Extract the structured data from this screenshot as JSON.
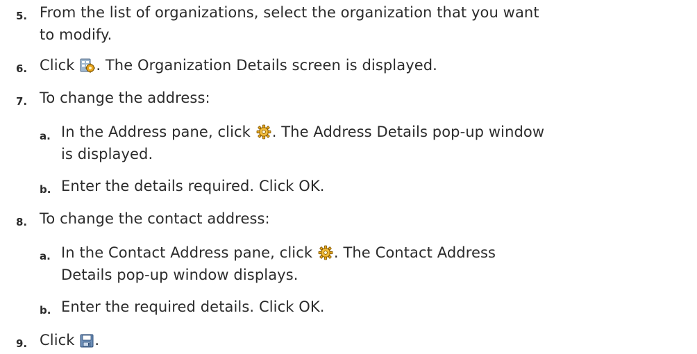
{
  "steps": [
    {
      "number": "5.",
      "line1": "From the list of organizations, select the organization that you want",
      "line2": "to modify."
    },
    {
      "number": "6.",
      "before": "Click ",
      "icon": "organization-details-icon",
      "after": ". The Organization Details screen is displayed."
    },
    {
      "number": "7.",
      "text": "To change the address:",
      "substeps": [
        {
          "letter": "a.",
          "before": "In the Address pane, click ",
          "icon": "gear-icon",
          "after": ". The Address Details pop-up window",
          "line2": "is displayed."
        },
        {
          "letter": "b.",
          "text": "Enter the details required. Click OK."
        }
      ]
    },
    {
      "number": "8.",
      "text": "To change the contact address:",
      "substeps": [
        {
          "letter": "a.",
          "before": "In the Contact Address pane, click ",
          "icon": "gear-icon",
          "after": ". The Contact Address",
          "line2": "Details pop-up window displays."
        },
        {
          "letter": "b.",
          "text": "Enter the required details. Click OK."
        }
      ]
    },
    {
      "number": "9.",
      "before": "Click ",
      "icon": "save-icon",
      "after": "."
    }
  ]
}
